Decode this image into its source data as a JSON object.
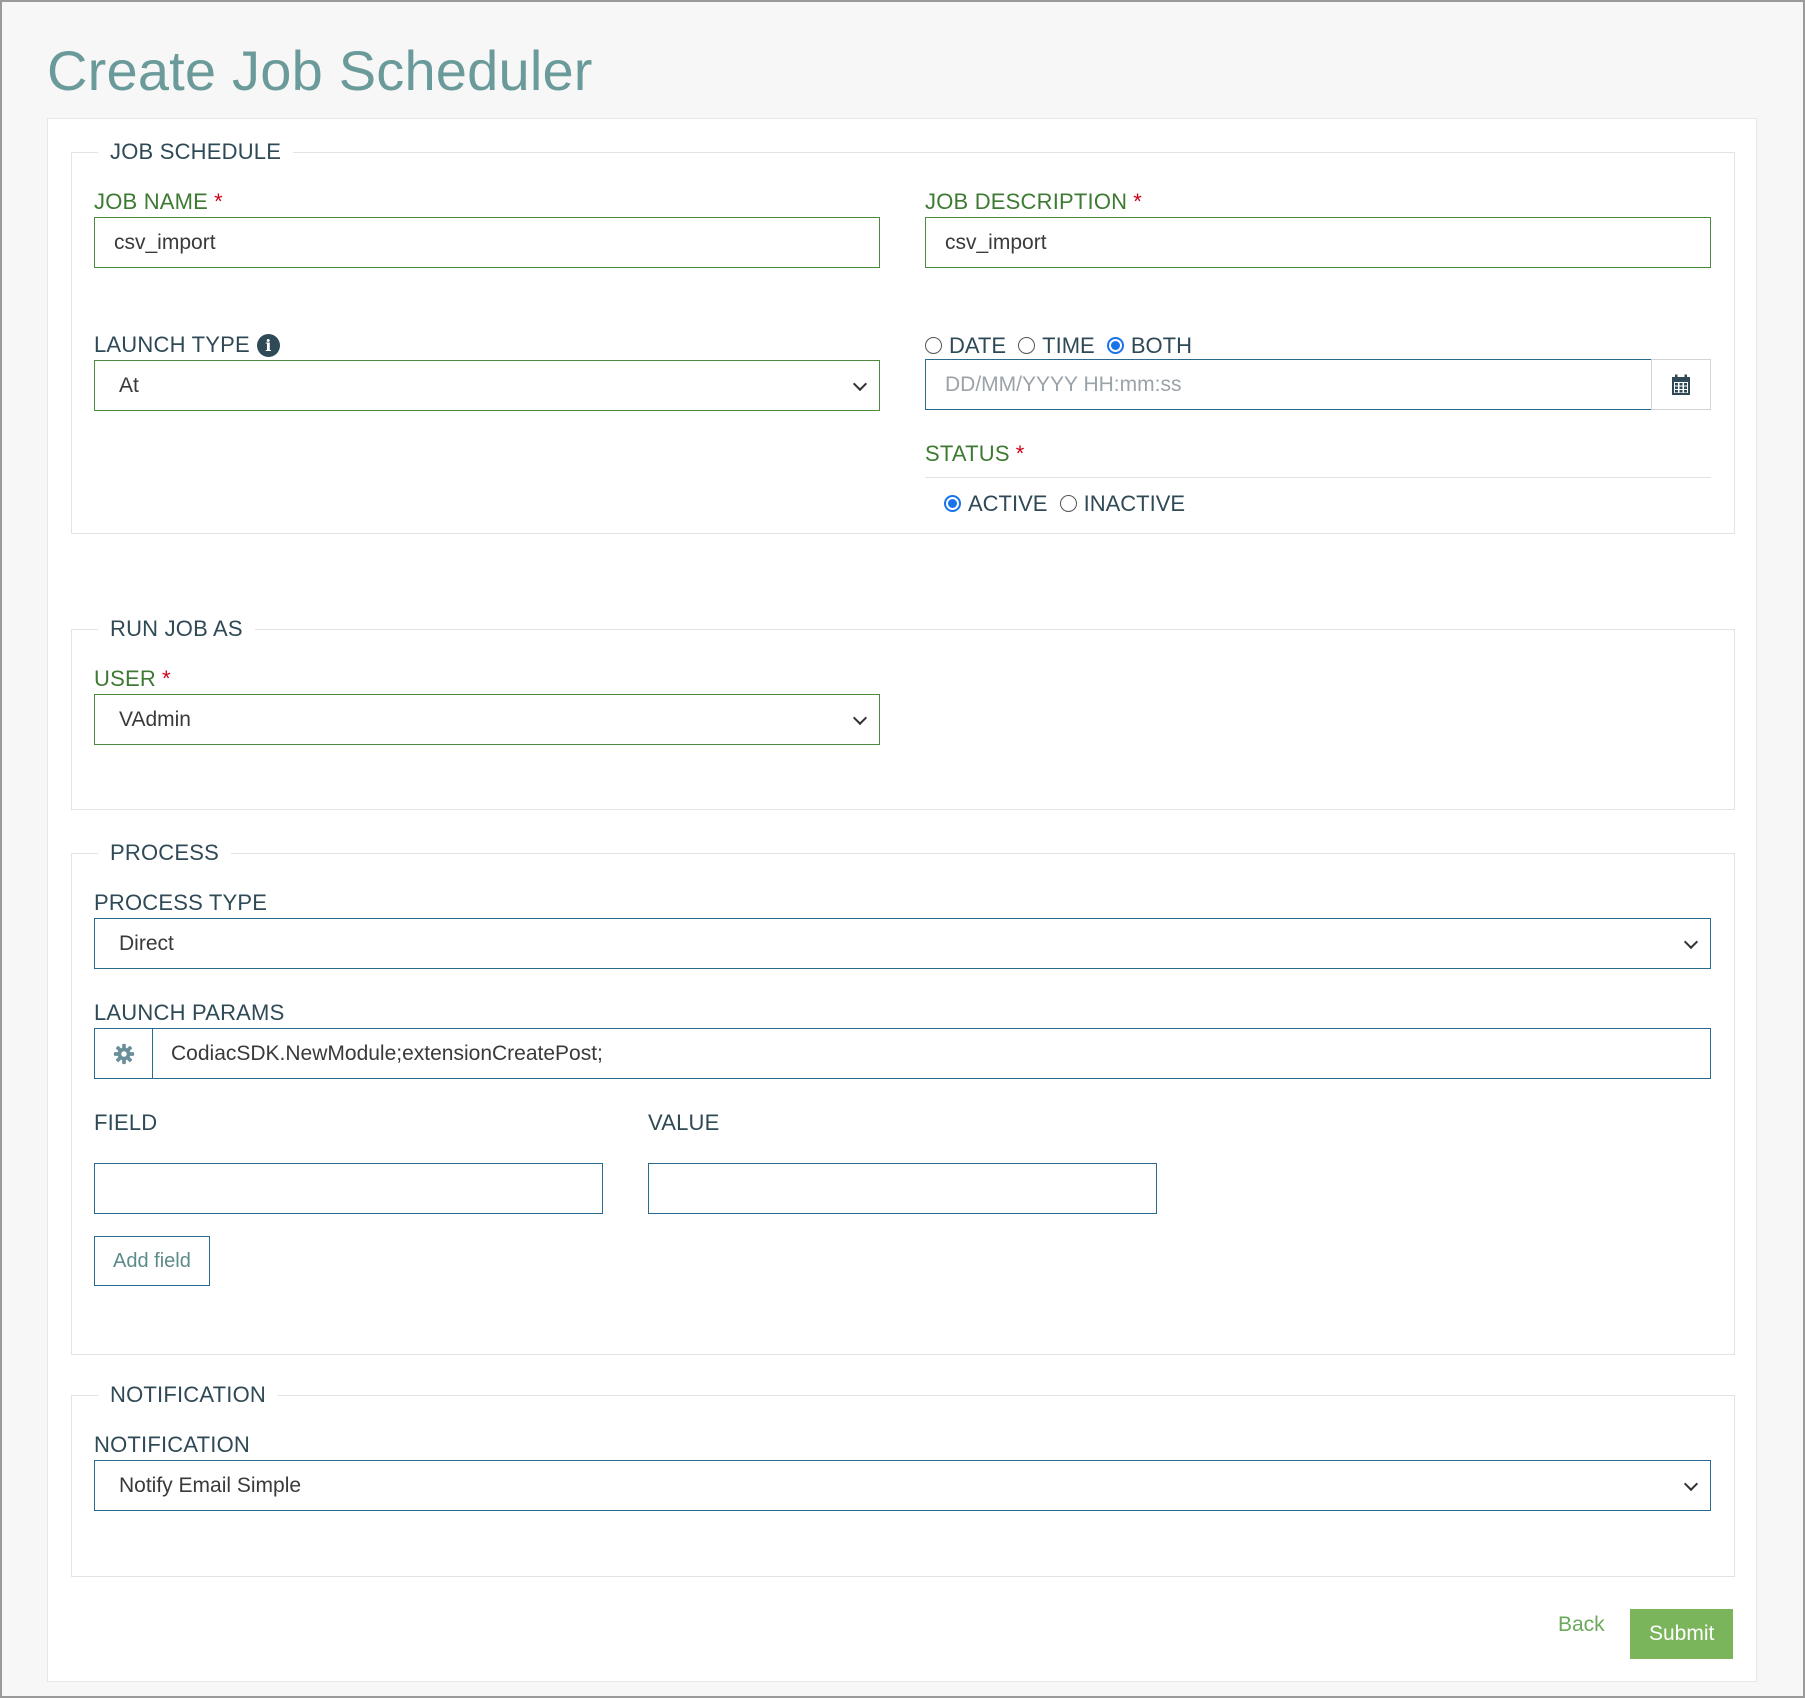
{
  "page": {
    "title": "Create Job Scheduler"
  },
  "sections": {
    "job_schedule": {
      "legend": "JOB SCHEDULE",
      "job_name": {
        "label": "JOB NAME",
        "required_mark": "*",
        "value": "csv_import"
      },
      "job_description": {
        "label": "JOB DESCRIPTION",
        "required_mark": "*",
        "value": "csv_import"
      },
      "launch_type": {
        "label": "LAUNCH TYPE",
        "info_icon": "info-circle-icon",
        "selected": "At"
      },
      "datetime_mode": {
        "options": [
          {
            "label": "DATE",
            "checked": false
          },
          {
            "label": "TIME",
            "checked": false
          },
          {
            "label": "BOTH",
            "checked": true
          }
        ]
      },
      "datetime_input": {
        "placeholder": "DD/MM/YYYY HH:mm:ss",
        "value": "",
        "icon": "calendar-icon"
      },
      "status": {
        "label": "STATUS",
        "required_mark": "*",
        "options": [
          {
            "label": "ACTIVE",
            "checked": true
          },
          {
            "label": "INACTIVE",
            "checked": false
          }
        ]
      }
    },
    "run_job_as": {
      "legend": "RUN JOB AS",
      "user": {
        "label": "USER",
        "required_mark": "*",
        "selected": "VAdmin"
      }
    },
    "process": {
      "legend": "PROCESS",
      "process_type": {
        "label": "PROCESS TYPE",
        "selected": "Direct"
      },
      "launch_params": {
        "label": "LAUNCH PARAMS",
        "value": "CodiacSDK.NewModule;extensionCreatePost;",
        "icon": "gear-icon"
      },
      "field": {
        "label": "FIELD",
        "value": ""
      },
      "value": {
        "label": "VALUE",
        "value": ""
      },
      "add_field_label": "Add field"
    },
    "notification": {
      "legend": "NOTIFICATION",
      "notification": {
        "label": "NOTIFICATION",
        "selected": "Notify Email Simple"
      }
    }
  },
  "footer": {
    "back_label": "Back",
    "submit_label": "Submit"
  },
  "colors": {
    "title": "#6a9a9a",
    "label_green": "#3e7a33",
    "required": "#d0021b",
    "input_border_green": "#4d8a3f",
    "input_border_blue": "#2b6a8f",
    "submit_bg": "#7ab55c",
    "radio_checked": "#1a73e8"
  }
}
